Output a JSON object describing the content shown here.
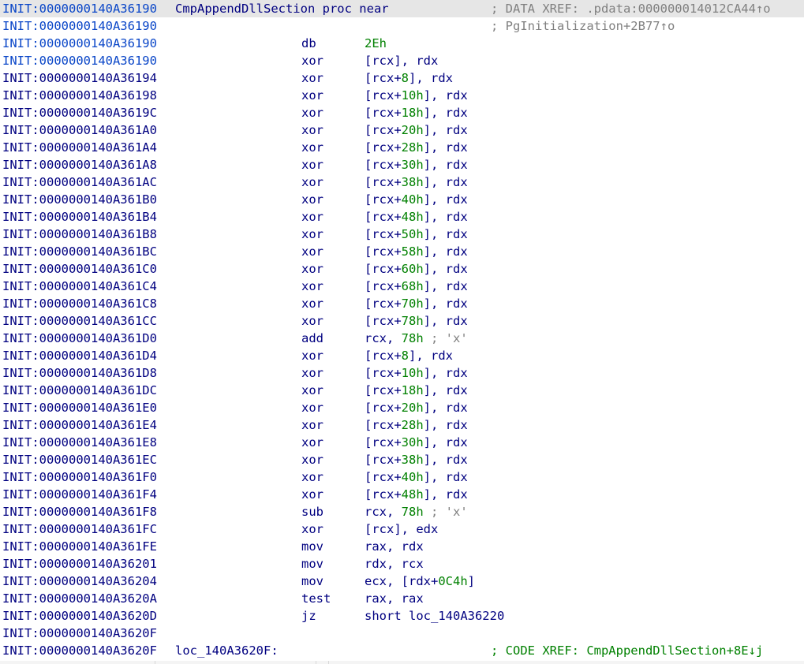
{
  "listing": [
    {
      "addr": "INIT:0000000140A36190",
      "label": "CmpAppendDllSection proc near",
      "xref": "; DATA XREF: .pdata:000000014012CA44↑o",
      "xref_kind": "data",
      "highlight": true,
      "addr_blue": true
    },
    {
      "addr": "INIT:0000000140A36190",
      "xref": "; PgInitialization+2B77↑o",
      "xref_kind": "data",
      "addr_blue": true
    },
    {
      "addr": "INIT:0000000140A36190",
      "mnemonic": "db",
      "operands": [
        {
          "t": "2Eh",
          "k": "num"
        }
      ],
      "addr_blue": true
    },
    {
      "addr": "INIT:0000000140A36190",
      "mnemonic": "xor",
      "operands": [
        {
          "t": "[rcx], rdx"
        }
      ],
      "addr_blue": true
    },
    {
      "addr": "INIT:0000000140A36194",
      "mnemonic": "xor",
      "operands": [
        {
          "t": "[rcx+"
        },
        {
          "t": "8",
          "k": "num"
        },
        {
          "t": "], rdx"
        }
      ]
    },
    {
      "addr": "INIT:0000000140A36198",
      "mnemonic": "xor",
      "operands": [
        {
          "t": "[rcx+"
        },
        {
          "t": "10h",
          "k": "num"
        },
        {
          "t": "], rdx"
        }
      ]
    },
    {
      "addr": "INIT:0000000140A3619C",
      "mnemonic": "xor",
      "operands": [
        {
          "t": "[rcx+"
        },
        {
          "t": "18h",
          "k": "num"
        },
        {
          "t": "], rdx"
        }
      ]
    },
    {
      "addr": "INIT:0000000140A361A0",
      "mnemonic": "xor",
      "operands": [
        {
          "t": "[rcx+"
        },
        {
          "t": "20h",
          "k": "num"
        },
        {
          "t": "], rdx"
        }
      ]
    },
    {
      "addr": "INIT:0000000140A361A4",
      "mnemonic": "xor",
      "operands": [
        {
          "t": "[rcx+"
        },
        {
          "t": "28h",
          "k": "num"
        },
        {
          "t": "], rdx"
        }
      ]
    },
    {
      "addr": "INIT:0000000140A361A8",
      "mnemonic": "xor",
      "operands": [
        {
          "t": "[rcx+"
        },
        {
          "t": "30h",
          "k": "num"
        },
        {
          "t": "], rdx"
        }
      ]
    },
    {
      "addr": "INIT:0000000140A361AC",
      "mnemonic": "xor",
      "operands": [
        {
          "t": "[rcx+"
        },
        {
          "t": "38h",
          "k": "num"
        },
        {
          "t": "], rdx"
        }
      ]
    },
    {
      "addr": "INIT:0000000140A361B0",
      "mnemonic": "xor",
      "operands": [
        {
          "t": "[rcx+"
        },
        {
          "t": "40h",
          "k": "num"
        },
        {
          "t": "], rdx"
        }
      ]
    },
    {
      "addr": "INIT:0000000140A361B4",
      "mnemonic": "xor",
      "operands": [
        {
          "t": "[rcx+"
        },
        {
          "t": "48h",
          "k": "num"
        },
        {
          "t": "], rdx"
        }
      ]
    },
    {
      "addr": "INIT:0000000140A361B8",
      "mnemonic": "xor",
      "operands": [
        {
          "t": "[rcx+"
        },
        {
          "t": "50h",
          "k": "num"
        },
        {
          "t": "], rdx"
        }
      ]
    },
    {
      "addr": "INIT:0000000140A361BC",
      "mnemonic": "xor",
      "operands": [
        {
          "t": "[rcx+"
        },
        {
          "t": "58h",
          "k": "num"
        },
        {
          "t": "], rdx"
        }
      ]
    },
    {
      "addr": "INIT:0000000140A361C0",
      "mnemonic": "xor",
      "operands": [
        {
          "t": "[rcx+"
        },
        {
          "t": "60h",
          "k": "num"
        },
        {
          "t": "], rdx"
        }
      ]
    },
    {
      "addr": "INIT:0000000140A361C4",
      "mnemonic": "xor",
      "operands": [
        {
          "t": "[rcx+"
        },
        {
          "t": "68h",
          "k": "num"
        },
        {
          "t": "], rdx"
        }
      ]
    },
    {
      "addr": "INIT:0000000140A361C8",
      "mnemonic": "xor",
      "operands": [
        {
          "t": "[rcx+"
        },
        {
          "t": "70h",
          "k": "num"
        },
        {
          "t": "], rdx"
        }
      ]
    },
    {
      "addr": "INIT:0000000140A361CC",
      "mnemonic": "xor",
      "operands": [
        {
          "t": "[rcx+"
        },
        {
          "t": "78h",
          "k": "num"
        },
        {
          "t": "], rdx"
        }
      ]
    },
    {
      "addr": "INIT:0000000140A361D0",
      "mnemonic": "add",
      "operands": [
        {
          "t": "rcx, "
        },
        {
          "t": "78h",
          "k": "num"
        },
        {
          "t": " ; 'x'",
          "k": "cmt"
        }
      ]
    },
    {
      "addr": "INIT:0000000140A361D4",
      "mnemonic": "xor",
      "operands": [
        {
          "t": "[rcx+"
        },
        {
          "t": "8",
          "k": "num"
        },
        {
          "t": "], rdx"
        }
      ]
    },
    {
      "addr": "INIT:0000000140A361D8",
      "mnemonic": "xor",
      "operands": [
        {
          "t": "[rcx+"
        },
        {
          "t": "10h",
          "k": "num"
        },
        {
          "t": "], rdx"
        }
      ]
    },
    {
      "addr": "INIT:0000000140A361DC",
      "mnemonic": "xor",
      "operands": [
        {
          "t": "[rcx+"
        },
        {
          "t": "18h",
          "k": "num"
        },
        {
          "t": "], rdx"
        }
      ]
    },
    {
      "addr": "INIT:0000000140A361E0",
      "mnemonic": "xor",
      "operands": [
        {
          "t": "[rcx+"
        },
        {
          "t": "20h",
          "k": "num"
        },
        {
          "t": "], rdx"
        }
      ]
    },
    {
      "addr": "INIT:0000000140A361E4",
      "mnemonic": "xor",
      "operands": [
        {
          "t": "[rcx+"
        },
        {
          "t": "28h",
          "k": "num"
        },
        {
          "t": "], rdx"
        }
      ]
    },
    {
      "addr": "INIT:0000000140A361E8",
      "mnemonic": "xor",
      "operands": [
        {
          "t": "[rcx+"
        },
        {
          "t": "30h",
          "k": "num"
        },
        {
          "t": "], rdx"
        }
      ]
    },
    {
      "addr": "INIT:0000000140A361EC",
      "mnemonic": "xor",
      "operands": [
        {
          "t": "[rcx+"
        },
        {
          "t": "38h",
          "k": "num"
        },
        {
          "t": "], rdx"
        }
      ]
    },
    {
      "addr": "INIT:0000000140A361F0",
      "mnemonic": "xor",
      "operands": [
        {
          "t": "[rcx+"
        },
        {
          "t": "40h",
          "k": "num"
        },
        {
          "t": "], rdx"
        }
      ]
    },
    {
      "addr": "INIT:0000000140A361F4",
      "mnemonic": "xor",
      "operands": [
        {
          "t": "[rcx+"
        },
        {
          "t": "48h",
          "k": "num"
        },
        {
          "t": "], rdx"
        }
      ]
    },
    {
      "addr": "INIT:0000000140A361F8",
      "mnemonic": "sub",
      "operands": [
        {
          "t": "rcx, "
        },
        {
          "t": "78h",
          "k": "num"
        },
        {
          "t": " ; 'x'",
          "k": "cmt"
        }
      ]
    },
    {
      "addr": "INIT:0000000140A361FC",
      "mnemonic": "xor",
      "operands": [
        {
          "t": "[rcx], edx"
        }
      ]
    },
    {
      "addr": "INIT:0000000140A361FE",
      "mnemonic": "mov",
      "operands": [
        {
          "t": "rax, rdx"
        }
      ]
    },
    {
      "addr": "INIT:0000000140A36201",
      "mnemonic": "mov",
      "operands": [
        {
          "t": "rdx, rcx"
        }
      ]
    },
    {
      "addr": "INIT:0000000140A36204",
      "mnemonic": "mov",
      "operands": [
        {
          "t": "ecx, [rdx+"
        },
        {
          "t": "0C4h",
          "k": "num"
        },
        {
          "t": "]"
        }
      ]
    },
    {
      "addr": "INIT:0000000140A3620A",
      "mnemonic": "test",
      "operands": [
        {
          "t": "rax, rax"
        }
      ]
    },
    {
      "addr": "INIT:0000000140A3620D",
      "mnemonic": "jz",
      "operands": [
        {
          "t": "short loc_140A36220"
        }
      ]
    },
    {
      "addr": "INIT:0000000140A3620F"
    },
    {
      "addr": "INIT:0000000140A3620F",
      "label": "loc_140A3620F:",
      "xref": "; CODE XREF: CmpAppendDllSection+8E↓j",
      "xref_kind": "code"
    }
  ]
}
